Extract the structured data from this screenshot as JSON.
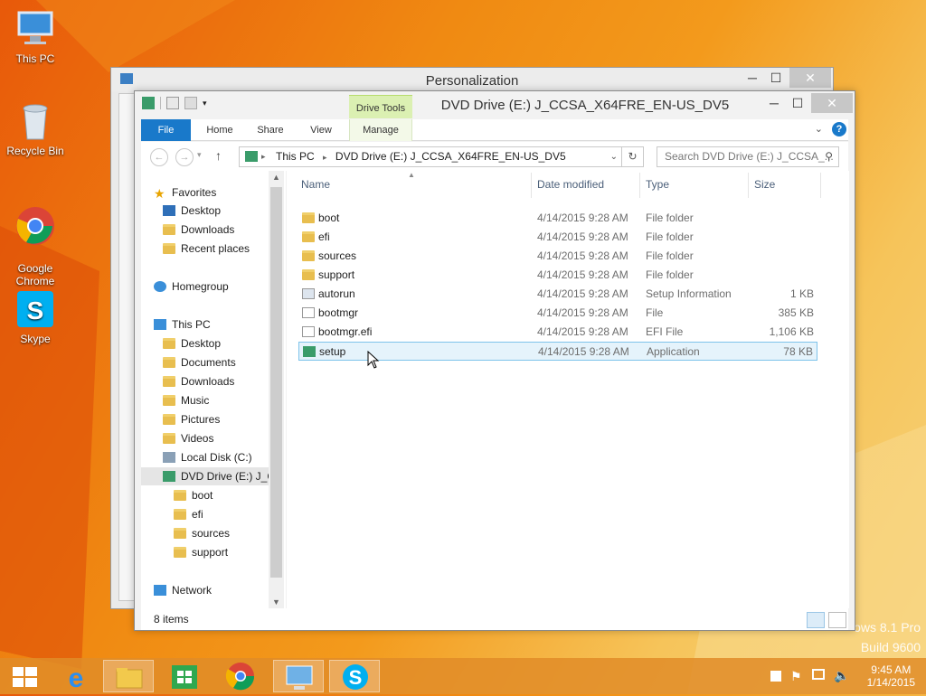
{
  "desktop": {
    "icons": [
      {
        "label": "This PC",
        "icon": "this-pc-icon"
      },
      {
        "label": "Recycle Bin",
        "icon": "recycle-bin-icon"
      },
      {
        "label": "Google\nChrome",
        "icon": "chrome-icon"
      },
      {
        "label": "Skype",
        "icon": "skype-icon"
      }
    ],
    "watermark_line1": "ows 8.1 Pro",
    "watermark_line2": "Build 9600"
  },
  "back_window": {
    "title": "Personalization"
  },
  "window": {
    "title": "DVD Drive (E:) J_CCSA_X64FRE_EN-US_DV5",
    "contextual_tab": "Drive Tools",
    "tabs": [
      "File",
      "Home",
      "Share",
      "View",
      "Manage"
    ],
    "address": {
      "parts": [
        "This PC",
        "DVD Drive (E:) J_CCSA_X64FRE_EN-US_DV5"
      ]
    },
    "search_placeholder": "Search DVD Drive (E:) J_CCSA_...",
    "nav": {
      "favorites": "Favorites",
      "fav_items": [
        "Desktop",
        "Downloads",
        "Recent places"
      ],
      "homegroup": "Homegroup",
      "thispc": "This PC",
      "pc_items": [
        "Desktop",
        "Documents",
        "Downloads",
        "Music",
        "Pictures",
        "Videos",
        "Local Disk (C:)",
        "DVD Drive (E:) J_C"
      ],
      "dvd_items": [
        "boot",
        "efi",
        "sources",
        "support"
      ],
      "network": "Network"
    },
    "columns": [
      "Name",
      "Date modified",
      "Type",
      "Size"
    ],
    "files": [
      {
        "name": "boot",
        "date": "4/14/2015 9:28 AM",
        "type": "File folder",
        "size": "",
        "kind": "folder"
      },
      {
        "name": "efi",
        "date": "4/14/2015 9:28 AM",
        "type": "File folder",
        "size": "",
        "kind": "folder"
      },
      {
        "name": "sources",
        "date": "4/14/2015 9:28 AM",
        "type": "File folder",
        "size": "",
        "kind": "folder"
      },
      {
        "name": "support",
        "date": "4/14/2015 9:28 AM",
        "type": "File folder",
        "size": "",
        "kind": "folder"
      },
      {
        "name": "autorun",
        "date": "4/14/2015 9:28 AM",
        "type": "Setup Information",
        "size": "1 KB",
        "kind": "settings"
      },
      {
        "name": "bootmgr",
        "date": "4/14/2015 9:28 AM",
        "type": "File",
        "size": "385 KB",
        "kind": "file"
      },
      {
        "name": "bootmgr.efi",
        "date": "4/14/2015 9:28 AM",
        "type": "EFI File",
        "size": "1,106 KB",
        "kind": "file"
      },
      {
        "name": "setup",
        "date": "4/14/2015 9:28 AM",
        "type": "Application",
        "size": "78 KB",
        "kind": "app",
        "selected": true
      }
    ],
    "status": "8 items"
  },
  "taskbar": {
    "apps": [
      "start-icon",
      "internet-explorer-icon",
      "file-explorer-icon",
      "store-icon",
      "chrome-icon",
      "control-panel-icon",
      "skype-icon"
    ],
    "time": "9:45 AM",
    "date": "1/14/2015"
  }
}
